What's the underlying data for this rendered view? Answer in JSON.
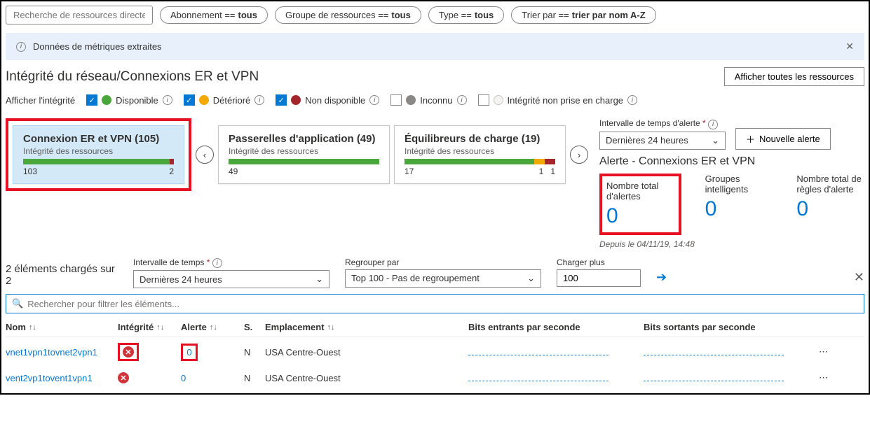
{
  "filters": {
    "search_placeholder": "Recherche de ressources directes...",
    "subscription": {
      "label": "Abonnement == ",
      "value": "tous"
    },
    "resource_group": {
      "label": "Groupe de ressources == ",
      "value": "tous"
    },
    "type": {
      "label": "Type == ",
      "value": "tous"
    },
    "sort": {
      "label": "Trier par == ",
      "value": "trier par nom A-Z"
    }
  },
  "banner": {
    "text": "Données de métriques extraites"
  },
  "page": {
    "title": "Intégrité du réseau/Connexions ER et VPN",
    "show_all_resources": "Afficher toutes les ressources"
  },
  "health_legend": {
    "label": "Afficher l'intégrité",
    "available": "Disponible",
    "degraded": "Détérioré",
    "unavailable": "Non disponible",
    "unknown": "Inconnu",
    "unsupported": "Intégrité non prise en charge"
  },
  "cards": {
    "sub_label": "Intégrité des ressources",
    "c1": {
      "title": "Connexion ER et VPN (105)",
      "left": "103",
      "right": "2"
    },
    "c2": {
      "title": "Passerelles d'application (49)",
      "left": "49",
      "right": ""
    },
    "c3": {
      "title": "Équilibreurs de charge (19)",
      "left": "17",
      "mid": "1",
      "right": "1"
    }
  },
  "alerts": {
    "interval_label": "Intervalle de temps d'alerte",
    "interval_value": "Dernières 24 heures",
    "new_alert": "Nouvelle alerte",
    "section_title": "Alerte - Connexions ER et VPN",
    "m1_label": "Nombre total d'alertes",
    "m1_value": "0",
    "m2_label": "Groupes intelligents",
    "m2_value": "0",
    "m3_label": "Nombre total de règles d'alerte",
    "m3_value": "0",
    "timestamp": "Depuis le 04/11/19, 14:48"
  },
  "controls": {
    "loaded_text": "2 éléments chargés sur 2",
    "time_interval_label": "Intervalle de temps",
    "time_interval_value": "Dernières 24 heures",
    "group_by_label": "Regrouper par",
    "group_by_value": "Top 100 - Pas de regroupement",
    "load_more_label": "Charger plus",
    "load_more_value": "100"
  },
  "search_placeholder": "Rechercher pour filtrer les éléments...",
  "table": {
    "h_name": "Nom",
    "h_health": "Intégrité",
    "h_alert": "Alerte",
    "h_s": "S.",
    "h_location": "Emplacement",
    "h_bits_in": "Bits entrants par seconde",
    "h_bits_out": "Bits sortants par seconde",
    "rows": [
      {
        "name": "vnet1vpn1tovnet2vpn1",
        "alert": "0",
        "s": "N",
        "location": "USA Centre-Ouest"
      },
      {
        "name": "vent2vp1tovent1vpn1",
        "alert": "0",
        "s": "N",
        "location": "USA Centre-Ouest"
      }
    ]
  }
}
